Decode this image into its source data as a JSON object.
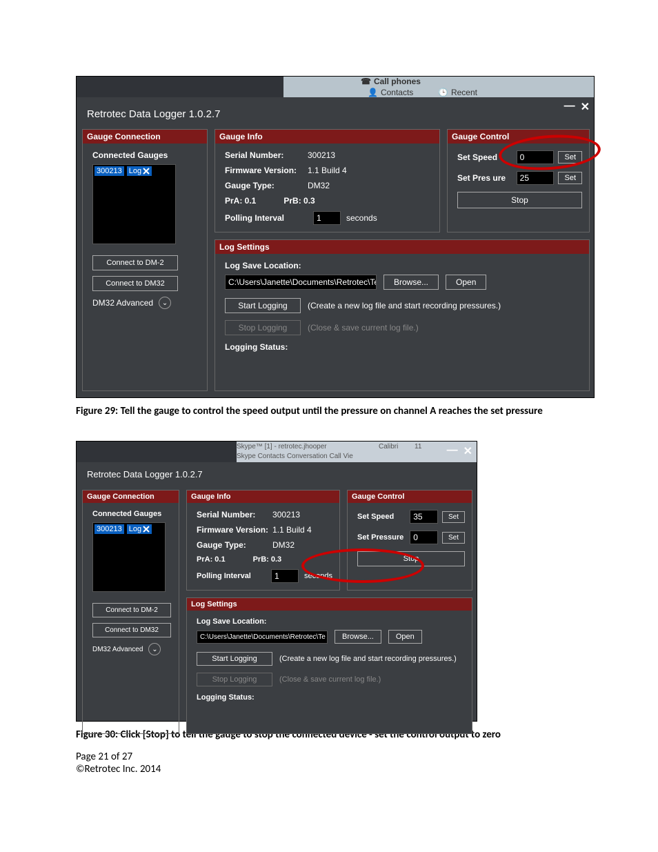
{
  "app": {
    "title": "Retrotec Data Logger 1.0.2.7"
  },
  "bgTabs": {
    "tab1": "Call phones",
    "tab2": "Contacts",
    "tab3": "Recent"
  },
  "bgTabs2": {
    "a": "Skype™ [1] - retrotec.jhooper",
    "b": "Skype  Contacts  Conversation  Call  Vie",
    "c": "Calibri",
    "d": "11"
  },
  "fig29": {
    "gaugeConnection": {
      "header": "Gauge Connection",
      "connectedLabel": "Connected Gauges",
      "item": "300213",
      "logTag": "Log",
      "connectDM2": "Connect to DM-2",
      "connectDM32": "Connect to DM32",
      "advanced": "DM32 Advanced"
    },
    "gaugeInfo": {
      "header": "Gauge Info",
      "serialLabel": "Serial Number:",
      "serialVal": "300213",
      "fwLabel": "Firmware Version:",
      "fwVal": "1.1 Build 4",
      "typeLabel": "Gauge Type:",
      "typeVal": "DM32",
      "prA": "PrA:    0.1",
      "prB": "PrB:  0.3",
      "pollLabel": "Polling Interval",
      "pollVal": "1",
      "pollUnit": "seconds"
    },
    "gaugeControl": {
      "header": "Gauge Control",
      "speedLabel": "Set Speed",
      "speedVal": "0",
      "pressLabel": "Set Pres ure",
      "pressVal": "25",
      "setBtn": "Set",
      "stopBtn": "Stop"
    },
    "logSettings": {
      "header": "Log Settings",
      "saveLabel": "Log Save Location:",
      "path": "C:\\Users\\Janette\\Documents\\Retrotec\\Te",
      "browse": "Browse...",
      "open": "Open",
      "startLog": "Start Logging",
      "startNote": "(Create a new log file and start recording pressures.)",
      "stopLog": "Stop Logging",
      "stopNote": "(Close & save current log file.)",
      "statusLabel": "Logging Status:"
    }
  },
  "fig30": {
    "gaugeControl": {
      "speedVal": "35",
      "pressVal": "0",
      "pressLabel": "Set Pressure"
    }
  },
  "captions": {
    "c29": "Figure 29:  Tell the gauge to control the speed output until the pressure on channel A reaches the set pressure",
    "c30": "Figure 30:  Click [Stop] to tell the gauge to stop the connected device - set the control output to zero"
  },
  "footer": {
    "page": "Page 21 of 27",
    "copyright": "©Retrotec Inc. 2014"
  }
}
